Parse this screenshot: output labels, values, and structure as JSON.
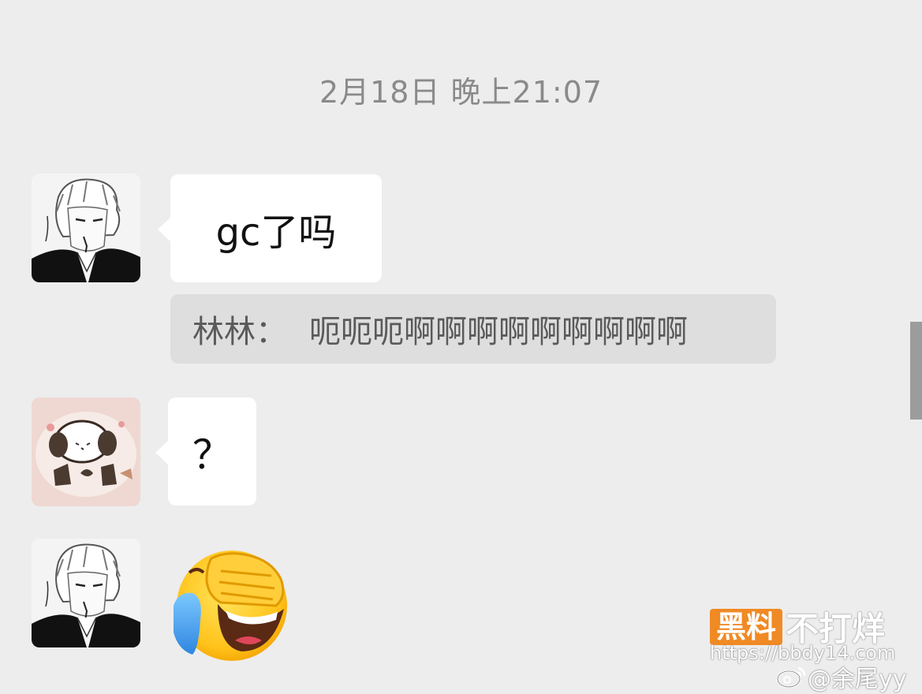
{
  "chat": {
    "timestamp": "2月18日 晚上21:07",
    "messages": [
      {
        "sender_avatar": "white-haired-character-avatar",
        "text": "gc了吗",
        "quote": {
          "name": "林林：",
          "text": "呃呃呃啊啊啊啊啊啊啊啊啊"
        }
      },
      {
        "sender_avatar": "puppy-sticker-avatar",
        "text": "？"
      },
      {
        "sender_avatar": "white-haired-character-avatar",
        "sticker": "face-palm-laughing-crying-emoji"
      }
    ]
  },
  "watermark": {
    "logo_box": "黑料",
    "logo_text": "不打烊",
    "url": "https://bbdy14.com",
    "weibo_handle": "@余尾yy"
  },
  "colors": {
    "background": "#ededed",
    "bubble": "#ffffff",
    "quote_bg": "#dedede",
    "timestamp_text": "#8a8a8a",
    "accent_orange": "#f08a24"
  }
}
